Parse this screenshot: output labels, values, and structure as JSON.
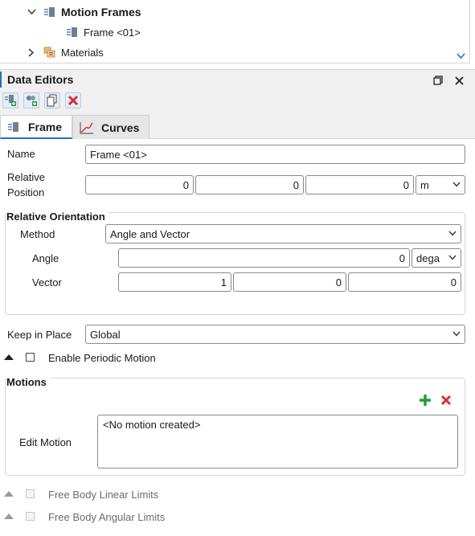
{
  "tree": {
    "motion_frames": "Motion Frames",
    "frame_item": "Frame <01>",
    "materials": "Materials"
  },
  "panel": {
    "title": "Data Editors"
  },
  "tabs": {
    "frame": "Frame",
    "curves": "Curves"
  },
  "form": {
    "name_label": "Name",
    "name_value": "Frame <01>",
    "rel_pos_label_1": "Relative",
    "rel_pos_label_2": "Position",
    "rel_pos_x": "0",
    "rel_pos_y": "0",
    "rel_pos_z": "0",
    "rel_pos_unit": "m",
    "orientation_title": "Relative Orientation",
    "method_label": "Method",
    "method_value": "Angle and Vector",
    "angle_label": "Angle",
    "angle_value": "0",
    "angle_unit": "dega",
    "vector_label": "Vector",
    "vector_x": "1",
    "vector_y": "0",
    "vector_z": "0",
    "keep_label": "Keep in Place",
    "keep_value": "Global",
    "periodic_label": "Enable Periodic Motion",
    "motions_title": "Motions",
    "edit_motion_label": "Edit Motion",
    "motion_list_text": "<No motion created>",
    "linear_limits_label": "Free Body Linear Limits",
    "angular_limits_label": "Free Body Angular Limits"
  },
  "colors": {
    "accent_blue": "#2a6ebb",
    "add_green": "#1f9d3a",
    "delete_red": "#d93030"
  }
}
